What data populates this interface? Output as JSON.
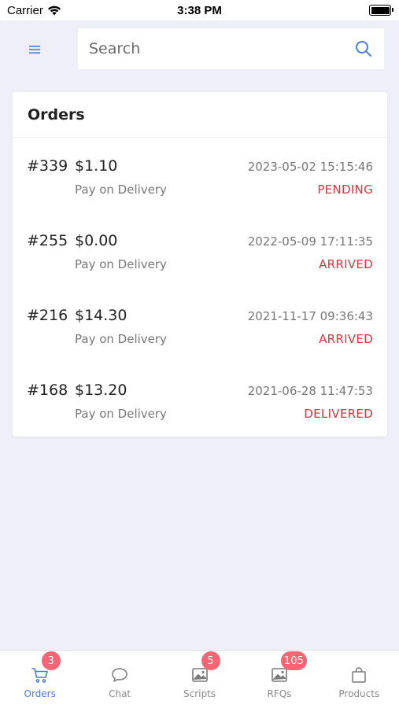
{
  "status_bar": {
    "carrier": "Carrier",
    "time": "3:38 PM"
  },
  "header": {
    "search_placeholder": "Search"
  },
  "orders_card": {
    "title": "Orders",
    "orders": [
      {
        "id": "#339",
        "amount": "$1.10",
        "payment": "Pay on Delivery",
        "datetime": "2023-05-02 15:15:46",
        "status": "PENDING"
      },
      {
        "id": "#255",
        "amount": "$0.00",
        "payment": "Pay on Delivery",
        "datetime": "2022-05-09 17:11:35",
        "status": "ARRIVED"
      },
      {
        "id": "#216",
        "amount": "$14.30",
        "payment": "Pay on Delivery",
        "datetime": "2021-11-17 09:36:43",
        "status": "ARRIVED"
      },
      {
        "id": "#168",
        "amount": "$13.20",
        "payment": "Pay on Delivery",
        "datetime": "2021-06-28 11:47:53",
        "status": "DELIVERED"
      }
    ]
  },
  "tab_bar": {
    "tabs": [
      {
        "label": "Orders",
        "icon": "cart-icon",
        "badge": "3",
        "active": true
      },
      {
        "label": "Chat",
        "icon": "chat-bubble-icon",
        "badge": "",
        "active": false
      },
      {
        "label": "Scripts",
        "icon": "image-icon",
        "badge": "5",
        "active": false
      },
      {
        "label": "RFQs",
        "icon": "image-icon",
        "badge": "105",
        "active": false
      },
      {
        "label": "Products",
        "icon": "shopping-bag-icon",
        "badge": "",
        "active": false
      }
    ]
  },
  "colors": {
    "accent": "#4a7bd9",
    "status_red": "#d9363e",
    "badge": "#f56574",
    "background": "#eeeff9"
  }
}
